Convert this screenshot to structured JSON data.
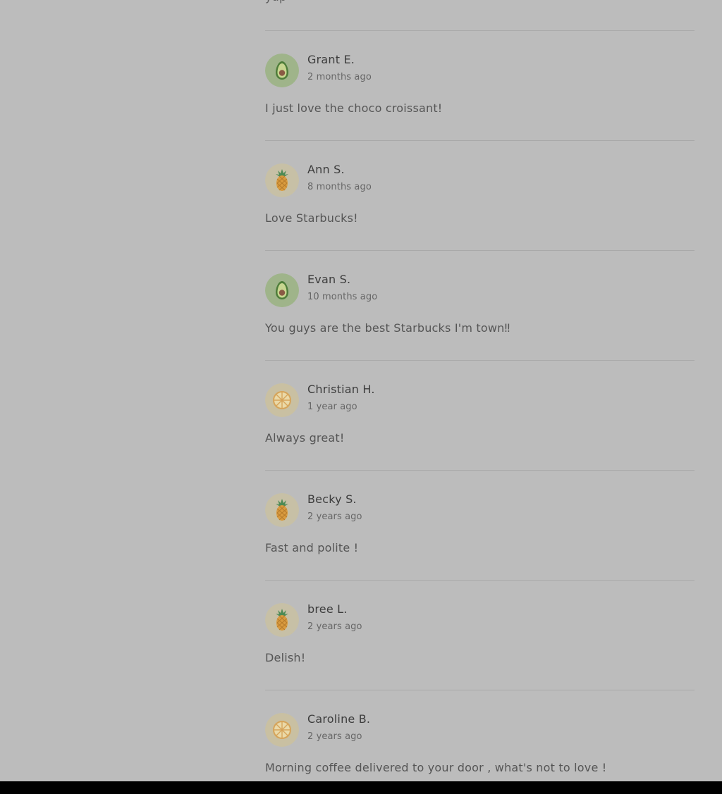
{
  "previous_review": {
    "text": "yup"
  },
  "reviews": [
    {
      "author": "Grant E.",
      "time": "2 months ago",
      "text": "I just love the choco croissant!",
      "avatar_icon": "avocado-icon"
    },
    {
      "author": "Ann S.",
      "time": "8 months ago",
      "text": "Love Starbucks!",
      "avatar_icon": "pineapple-icon"
    },
    {
      "author": "Evan S.",
      "time": "10 months ago",
      "text": "You guys are the best Starbucks I'm town‼",
      "avatar_icon": "avocado-icon"
    },
    {
      "author": "Christian H.",
      "time": "1 year ago",
      "text": "Always great!",
      "avatar_icon": "lemon-slice-icon"
    },
    {
      "author": "Becky S.",
      "time": "2 years ago",
      "text": "Fast and polite !",
      "avatar_icon": "pineapple-icon"
    },
    {
      "author": "bree L.",
      "time": "2 years ago",
      "text": "Delish!",
      "avatar_icon": "pineapple-icon"
    },
    {
      "author": "Caroline B.",
      "time": "2 years ago",
      "text": "Morning coffee delivered to your door , what's not to love !",
      "avatar_icon": "lemon-slice-icon"
    }
  ],
  "colors": {
    "overlay_background": "#bcbcbc",
    "avocado_avatar_bg": "#9fb48a",
    "pineapple_avatar_bg": "#c7c0a6",
    "lemon_avatar_bg": "#c9c0a2"
  }
}
